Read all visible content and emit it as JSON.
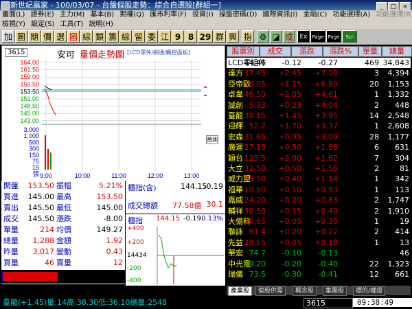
{
  "window": {
    "title": "新世紀贏家 - 100/03/07 - 台盤個股走勢：綜合自選股[群組一]"
  },
  "menu": {
    "row1": [
      "畫面(L)",
      "證券(E)",
      "主力(M)",
      "基本(B)",
      "期權(Q)",
      "匯市利率(F)",
      "投資(I)",
      "操盤密碼(D)",
      "國際資訊(I)",
      "金融(C)",
      "功能選擇(A)",
      "功能選擇(R)"
    ],
    "row2": [
      "檢視(Y)",
      "設定(S)",
      "工具(T)",
      "說明(H)"
    ]
  },
  "toolbar": {
    "buttons": [
      "加",
      "圖",
      "期",
      "價",
      "選",
      "圖",
      "綜",
      "類",
      "籌",
      "綜",
      "留",
      "委",
      "江",
      "9",
      "8",
      "29",
      "群",
      "興",
      "指",
      "⚙",
      "◪",
      "成",
      "Ex",
      "Page",
      "Page",
      "Scr"
    ]
  },
  "chart": {
    "code": "3615",
    "name": "安可",
    "title": "量價走勢圖",
    "subtitle": "[LCD零件/網通/觸控面板]",
    "price_labels": [
      "164.00",
      "161.50",
      "159.00",
      "156.50",
      "153.50",
      "151.00",
      "148.50",
      "145.00",
      "143.00"
    ],
    "volume_labels": [
      "3,000",
      "1,000",
      "500",
      "300",
      "150",
      "75",
      "15",
      "張"
    ],
    "time_labels": [
      "9:00",
      "10:00",
      "11:00",
      "12:00",
      "13:00"
    ],
    "annot": "預測"
  },
  "quote": {
    "rows": [
      {
        "l1": "開盤",
        "v1": "153.50",
        "l2": "振幅",
        "v2": "5.21%"
      },
      {
        "l1": "買進",
        "v1": "145.00",
        "l2": "最高",
        "v2": "153.50"
      },
      {
        "l1": "賣出",
        "v1": "145.50",
        "l2": "最低",
        "v2": "145.00"
      },
      {
        "l1": "成交",
        "v1": "145.50",
        "l2": "漲跌",
        "v2": "-8.00"
      },
      {
        "l1": "單量",
        "v1": "214",
        "l2": "均價",
        "v2": "149.27"
      },
      {
        "l1": "總量",
        "v1": "1,288",
        "l2": "金額",
        "v2": "1.92"
      },
      {
        "l1": "昨量",
        "v1": "3,017",
        "l2": "變動",
        "v2": "0.43"
      },
      {
        "l1": "買量",
        "v1": "46",
        "l2": "賣量",
        "v2": "12"
      }
    ]
  },
  "index": {
    "label": "櫃指(含)",
    "value": "144.15",
    "change": "-0.19",
    "turnover_label": "成交總額",
    "turnover": "77.58億",
    "turnover2": "30.1",
    "mini_label": "櫃指",
    "mini_value": "144.15",
    "mini_change": "-0.19",
    "mini_pct": "-0.13%",
    "mini_axis": [
      "+400",
      "+200",
      "14434",
      "-200",
      "-400"
    ]
  },
  "table": {
    "headers": [
      "股票別",
      "成交",
      "漲跌",
      "漲跌%",
      "單量",
      "總量"
    ],
    "rows": [
      {
        "name": "LCD零組件",
        "price": "44.46",
        "chg": "-0.12",
        "pct": "-0.27",
        "vol": "469",
        "total": "34,843"
      },
      {
        "name": "達方",
        "price": "37.45",
        "chg": "+2.45",
        "pct": "+7.00",
        "vol": "3",
        "total": "4,394"
      },
      {
        "name": "亞帝歐",
        "price": "18.05",
        "chg": "+1.15",
        "pct": "+6.80",
        "vol": "20",
        "total": "1,153"
      },
      {
        "name": "卓韋",
        "price": "46.50",
        "chg": "+2.05",
        "pct": "+4.61",
        "vol": "1",
        "total": "1,332"
      },
      {
        "name": "誠創",
        "price": "5.93",
        "chg": "+0.23",
        "pct": "+4.04",
        "vol": "2",
        "total": "448"
      },
      {
        "name": "臺龍",
        "price": "38.15",
        "chg": "+1.45",
        "pct": "+3.95",
        "vol": "14",
        "total": "2,548"
      },
      {
        "name": "迎輝",
        "price": "52.2",
        "chg": "+1.70",
        "pct": "+3.37",
        "vol": "1",
        "total": "2,608"
      },
      {
        "name": "宏森",
        "price": "31.65",
        "chg": "+0.95",
        "pct": "+3.09",
        "vol": "28",
        "total": "1,177"
      },
      {
        "name": "廣運",
        "price": "27.15",
        "chg": "+0.50",
        "pct": "+1.88",
        "vol": "6",
        "total": "631"
      },
      {
        "name": "穎台",
        "price": "125.5",
        "chg": "+2.00",
        "pct": "+1.62",
        "vol": "7",
        "total": "304"
      },
      {
        "name": "大立",
        "price": "32.50",
        "chg": "+0.50",
        "pct": "+1.56",
        "vol": "2",
        "total": "81"
      },
      {
        "name": "威力盟",
        "price": "35.50",
        "chg": "+0.40",
        "pct": "+1.14",
        "vol": "1",
        "total": "342"
      },
      {
        "name": "福華",
        "price": "10.80",
        "chg": "+0.10",
        "pct": "+0.93",
        "vol": "1",
        "total": "113"
      },
      {
        "name": "嘉威",
        "price": "24.20",
        "chg": "+0.20",
        "pct": "+0.83",
        "vol": "2",
        "total": "1,747"
      },
      {
        "name": "輔祥",
        "price": "30.50",
        "chg": "+0.15",
        "pct": "+0.49",
        "vol": "2",
        "total": "1,910"
      },
      {
        "name": "大億科",
        "price": "16.65",
        "chg": "+0.05",
        "pct": "+0.30",
        "vol": "1",
        "total": "19"
      },
      {
        "name": "聯詠",
        "price": "91.4",
        "chg": "+0.20",
        "pct": "+0.22",
        "vol": "2",
        "total": "414"
      },
      {
        "name": "先益",
        "price": "28.55",
        "chg": "+0.05",
        "pct": "+0.18",
        "vol": "1",
        "total": "13"
      },
      {
        "name": "華宏",
        "price": "74.7",
        "chg": "-0.10",
        "pct": "-0.13",
        "vol": "",
        "total": "46"
      },
      {
        "name": "中光電",
        "price": "49.20",
        "chg": "-0.20",
        "pct": "-0.40",
        "vol": "22",
        "total": "1,323"
      },
      {
        "name": "瑞儀",
        "price": "73.5",
        "chg": "-0.30",
        "pct": "-0.41",
        "vol": "12",
        "total": "661"
      }
    ]
  },
  "tabs": [
    "產業股",
    "個股供需",
    "概念股",
    "集團股",
    "標的/權證"
  ],
  "status": {
    "text": "臺龍(+1.45)量:14高:38.30低:36.10總量:2548",
    "code": "3615",
    "time": "09:38:49"
  },
  "colors": {
    "up": "#e00000",
    "down": "#00c000",
    "flat": "#ffffff",
    "header": "#c0d0e8",
    "price_line": "#e00000"
  }
}
